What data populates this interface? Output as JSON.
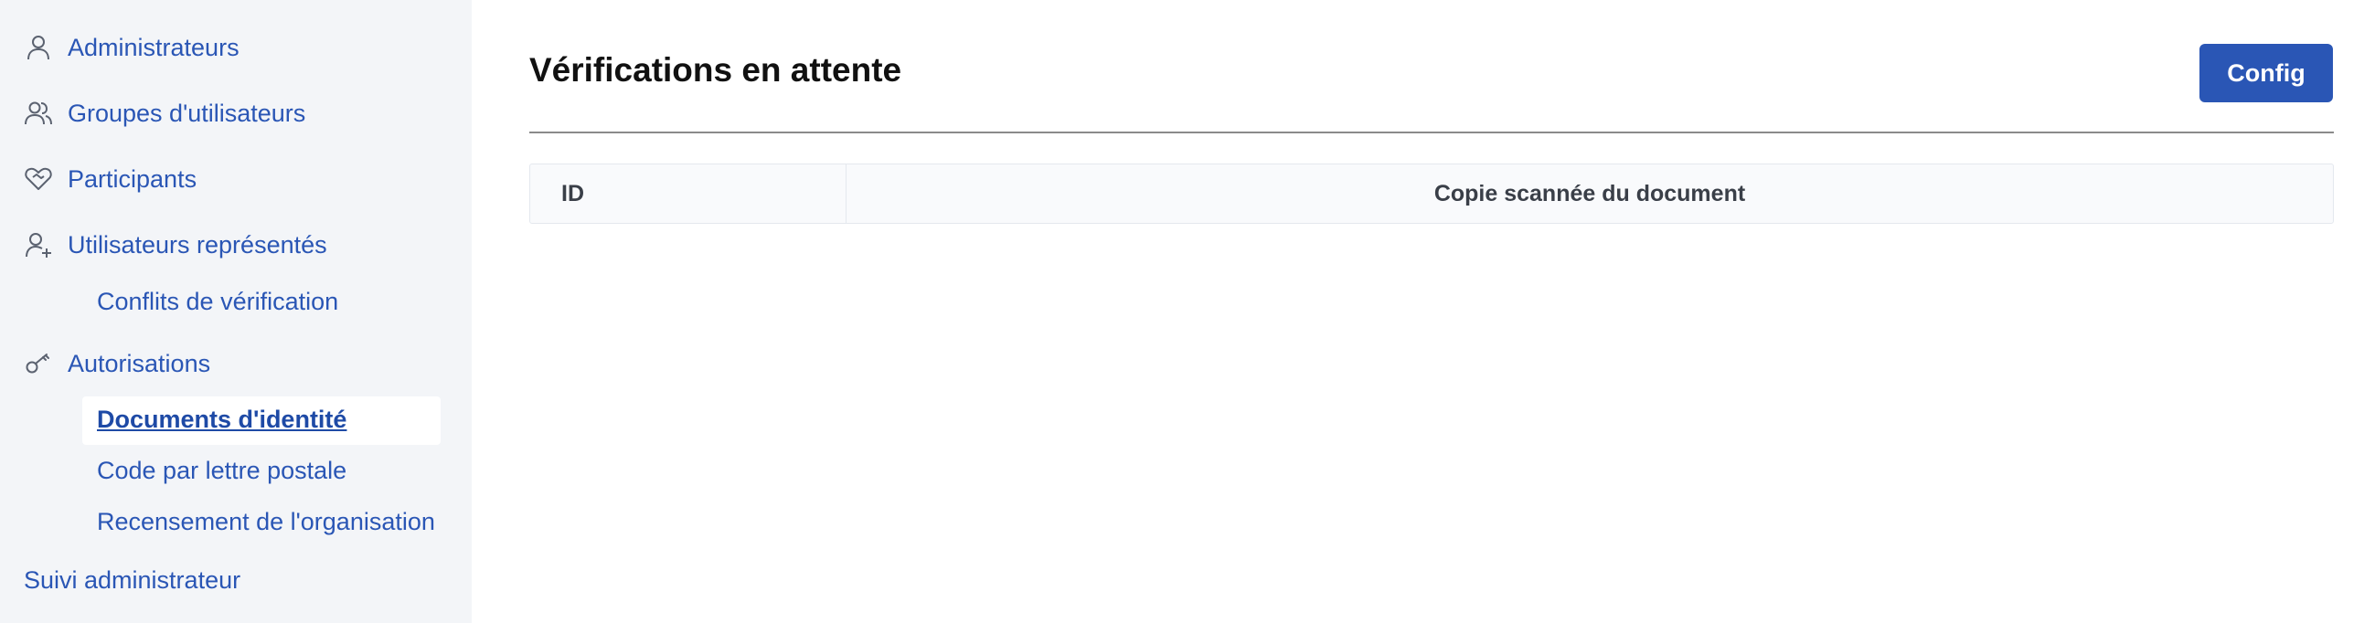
{
  "sidebar": {
    "items": [
      {
        "label": "Administrateurs",
        "icon": "user-icon"
      },
      {
        "label": "Groupes d'utilisateurs",
        "icon": "users-icon"
      },
      {
        "label": "Participants",
        "icon": "handshake-heart-icon"
      },
      {
        "label": "Utilisateurs représentés",
        "icon": "user-add-icon"
      },
      {
        "label": "Autorisations",
        "icon": "key-icon"
      }
    ],
    "verification_sub": [
      {
        "label": "Conflits de vérification"
      }
    ],
    "authorization_sub": [
      {
        "label": "Documents d'identité",
        "active": true
      },
      {
        "label": "Code par lettre postale"
      },
      {
        "label": "Recensement de l'organisation"
      }
    ],
    "footer_item": {
      "label": "Suivi administrateur"
    }
  },
  "main": {
    "title": "Vérifications en attente",
    "config_label": "Config",
    "table": {
      "columns": [
        "ID",
        "Copie scannée du document"
      ],
      "rows": []
    }
  },
  "colors": {
    "accent": "#2a56b5",
    "sidebar_bg": "#f3f5f8",
    "title": "#111111"
  }
}
